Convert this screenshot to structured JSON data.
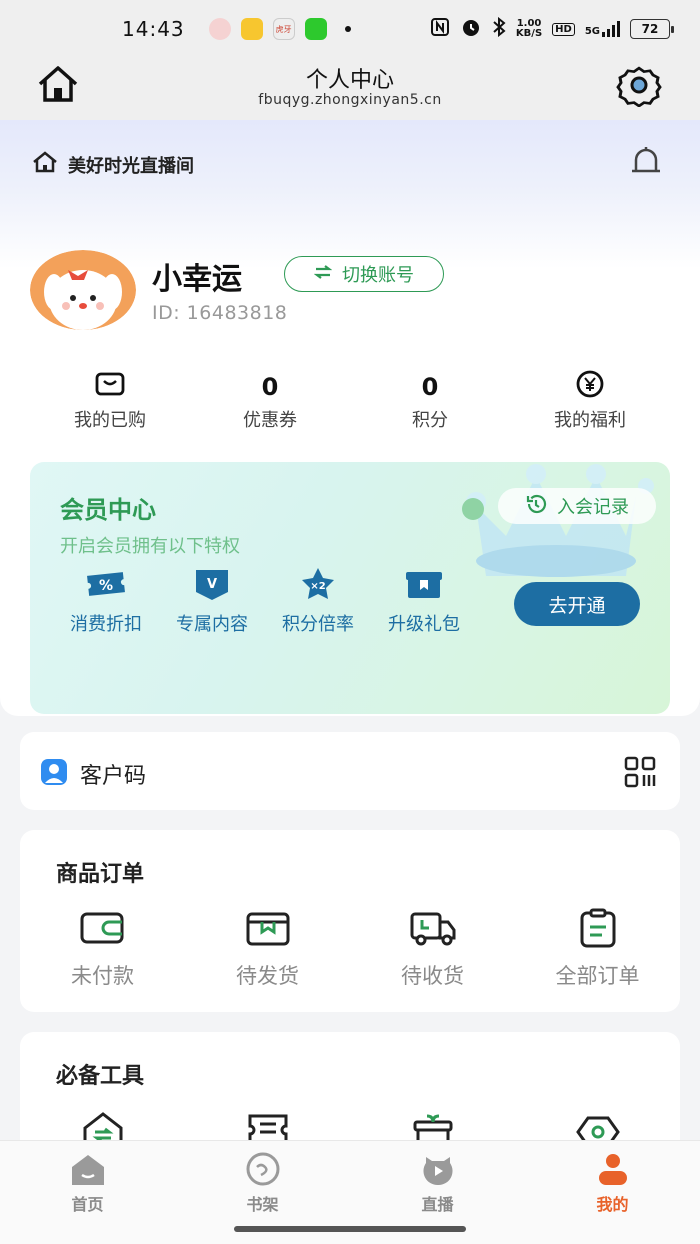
{
  "status_bar": {
    "time": "14:43",
    "speed_top": "1.00",
    "speed_bottom": "KB/S",
    "hd": "HD",
    "network": "5G",
    "battery": "72",
    "app_label_3": "虎牙"
  },
  "header": {
    "title": "个人中心",
    "url": "fbuqyg.zhongxinyan5.cn"
  },
  "room": {
    "label": "美好时光直播间"
  },
  "profile": {
    "username": "小幸运",
    "switch_label": "切换账号",
    "user_id": "ID: 16483818"
  },
  "stats": [
    {
      "label": "我的已购",
      "icon": "bag-icon"
    },
    {
      "value": "0",
      "label": "优惠券"
    },
    {
      "value": "0",
      "label": "积分"
    },
    {
      "label": "我的福利",
      "icon": "yen-coin-icon"
    }
  ],
  "member": {
    "title": "会员中心",
    "subtitle": "开启会员拥有以下特权",
    "join_record": "入会记录",
    "open_button": "去开通",
    "perks": [
      {
        "label": "消费折扣",
        "icon": "discount-ticket-icon",
        "glyph": "%"
      },
      {
        "label": "专属内容",
        "icon": "vip-shield-icon",
        "glyph": "V"
      },
      {
        "label": "积分倍率",
        "icon": "star-multiplier-icon",
        "glyph": "×2"
      },
      {
        "label": "升级礼包",
        "icon": "gift-box-icon",
        "glyph": ""
      }
    ],
    "colors": {
      "green": "#2e9a55",
      "blue": "#1d6ea3"
    }
  },
  "customer_code": {
    "label": "客户码"
  },
  "orders": {
    "title": "商品订单",
    "items": [
      {
        "label": "未付款",
        "icon": "wallet-icon"
      },
      {
        "label": "待发货",
        "icon": "package-icon"
      },
      {
        "label": "待收货",
        "icon": "truck-icon"
      },
      {
        "label": "全部订单",
        "icon": "clipboard-icon"
      }
    ]
  },
  "tools": {
    "title": "必备工具"
  },
  "tabs": [
    {
      "label": "首页",
      "icon": "home-tab-icon"
    },
    {
      "label": "书架",
      "icon": "bookshelf-tab-icon"
    },
    {
      "label": "直播",
      "icon": "live-tab-icon"
    },
    {
      "label": "我的",
      "icon": "profile-tab-icon",
      "active": true
    }
  ],
  "accent_color": "#e8622a"
}
